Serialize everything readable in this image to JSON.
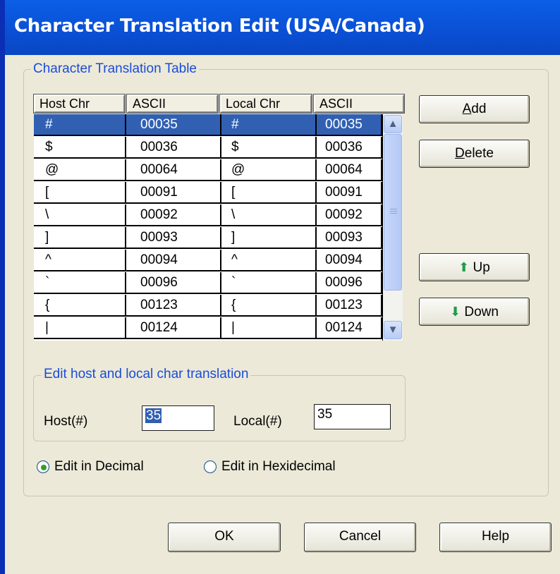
{
  "window": {
    "title": "Character Translation Edit (USA/Canada)"
  },
  "table_group": {
    "legend": "Character Translation Table"
  },
  "table": {
    "headers": [
      "Host Chr",
      "ASCII",
      "Local Chr",
      "ASCII"
    ],
    "rows": [
      [
        "#",
        "00035",
        "#",
        "00035"
      ],
      [
        "$",
        "00036",
        "$",
        "00036"
      ],
      [
        "@",
        "00064",
        "@",
        "00064"
      ],
      [
        "[",
        "00091",
        "[",
        "00091"
      ],
      [
        "\\",
        "00092",
        "\\",
        "00092"
      ],
      [
        "]",
        "00093",
        "]",
        "00093"
      ],
      [
        "^",
        "00094",
        "^",
        "00094"
      ],
      [
        "`",
        "00096",
        "`",
        "00096"
      ],
      [
        "{",
        "00123",
        "{",
        "00123"
      ],
      [
        "|",
        "00124",
        "|",
        "00124"
      ]
    ],
    "selected_row": 0
  },
  "side_buttons": {
    "add": {
      "accel": "A",
      "rest": "dd"
    },
    "delete": {
      "accel": "D",
      "rest": "elete"
    },
    "up": "Up",
    "down": "Down"
  },
  "edit_group": {
    "legend": "Edit host and local char translation",
    "host_label": "Host(#)",
    "host_value": "35",
    "local_label": "Local(#)",
    "local_value": "35"
  },
  "radios": {
    "decimal": {
      "label": "Edit in Decimal",
      "checked": true
    },
    "hex": {
      "label": "Edit in Hexidecimal",
      "checked": false
    }
  },
  "footer": {
    "ok": "OK",
    "cancel": "Cancel",
    "help": "Help"
  },
  "icons": {
    "up": "arrow-up-icon",
    "down": "arrow-down-icon",
    "scroll_up": "chevron-up-icon",
    "scroll_down": "chevron-down-icon"
  },
  "colors": {
    "title_bar": "#0a4fd4",
    "selection": "#3160b3",
    "legend_text": "#1a4cd8",
    "arrow_icon": "#1f9c4a"
  }
}
